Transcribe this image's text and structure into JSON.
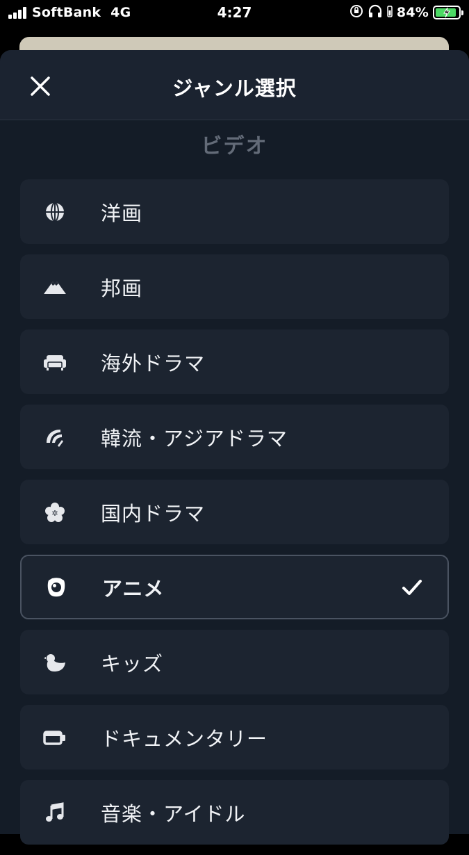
{
  "status_bar": {
    "carrier": "SoftBank",
    "network": "4G",
    "time": "4:27",
    "battery": "84%",
    "battery_color": "#4cd964"
  },
  "sheet": {
    "title": "ジャンル選択",
    "close_icon": "close-icon",
    "section_label": "ビデオ"
  },
  "genres": [
    {
      "label": "洋画",
      "icon": "globe-icon",
      "selected": false
    },
    {
      "label": "邦画",
      "icon": "mountain-icon",
      "selected": false
    },
    {
      "label": "海外ドラマ",
      "icon": "sofa-icon",
      "selected": false
    },
    {
      "label": "韓流・アジアドラマ",
      "icon": "hat-icon",
      "selected": false
    },
    {
      "label": "国内ドラマ",
      "icon": "flower-icon",
      "selected": false
    },
    {
      "label": "アニメ",
      "icon": "anime-eye-icon",
      "selected": true
    },
    {
      "label": "キッズ",
      "icon": "chick-icon",
      "selected": false
    },
    {
      "label": "ドキュメンタリー",
      "icon": "camera-icon",
      "selected": false
    },
    {
      "label": "音楽・アイドル",
      "icon": "music-note-icon",
      "selected": false
    }
  ],
  "colors": {
    "sheet_bg": "#141c27",
    "row_bg": "#1c2430",
    "section_label": "#636b78",
    "selected_border": "#4a5361"
  }
}
